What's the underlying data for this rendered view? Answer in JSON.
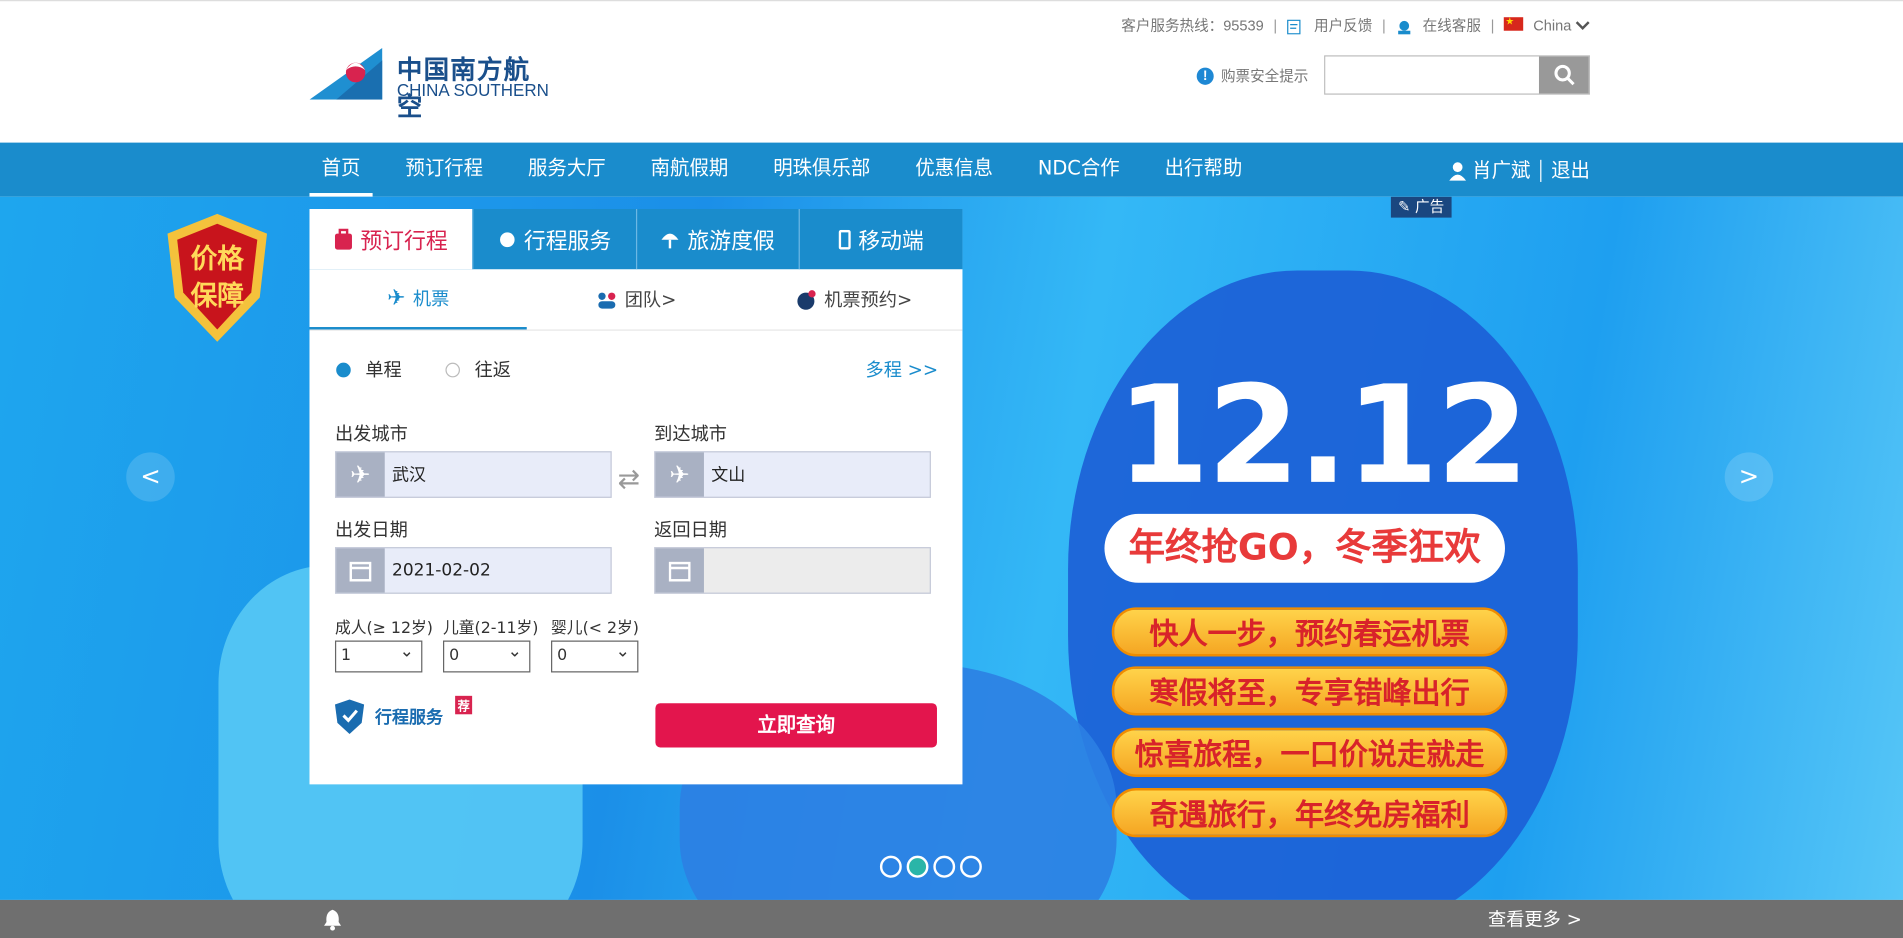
{
  "header": {
    "logo_cn": "中国南方航空",
    "logo_en": "CHINA SOUTHERN",
    "hotline": "客户服务热线：95539",
    "feedback": "用户反馈",
    "online_service": "在线客服",
    "region": "China",
    "safety_tip": "购票安全提示",
    "search_placeholder": ""
  },
  "nav": {
    "items": [
      "首页",
      "预订行程",
      "服务大厅",
      "南航假期",
      "明珠俱乐部",
      "优惠信息",
      "NDC合作",
      "出行帮助"
    ],
    "user_name": "肖广斌",
    "logout": "退出"
  },
  "banner": {
    "ad_tag": "广告",
    "badge_line1": "价格",
    "badge_line2": "保障",
    "promo_title": "12.12",
    "promo_sub": "年终抢GO，冬季狂欢",
    "pills": [
      "快人一步，预约春运机票",
      "寒假将至，专享错峰出行",
      "惊喜旅程，一口价说走就走",
      "奇遇旅行，年终免房福利"
    ],
    "prev": "<",
    "next": ">"
  },
  "panel": {
    "tabs": [
      "预订行程",
      "行程服务",
      "旅游度假",
      "移动端"
    ],
    "subtabs": [
      "机票",
      "团队>",
      "机票预约>"
    ],
    "one_way": "单程",
    "round_trip": "往返",
    "multi": "多程 >>",
    "from_label": "出发城市",
    "from_value": "武汉",
    "to_label": "到达城市",
    "to_value": "文山",
    "depart_label": "出发日期",
    "depart_value": "2021-02-02",
    "return_label": "返回日期",
    "return_value": "",
    "adult_label": "成人(≥ 12岁)",
    "child_label": "儿童(2-11岁)",
    "infant_label": "婴儿(< 2岁)",
    "adult_value": "1",
    "child_value": "0",
    "infant_value": "0",
    "service_label": "行程服务",
    "service_badge": "荐",
    "search_button": "立即查询"
  },
  "footer": {
    "more": "查看更多 >"
  },
  "colors": {
    "brand_blue": "#1a8ccc",
    "accent_red": "#e3154d"
  }
}
